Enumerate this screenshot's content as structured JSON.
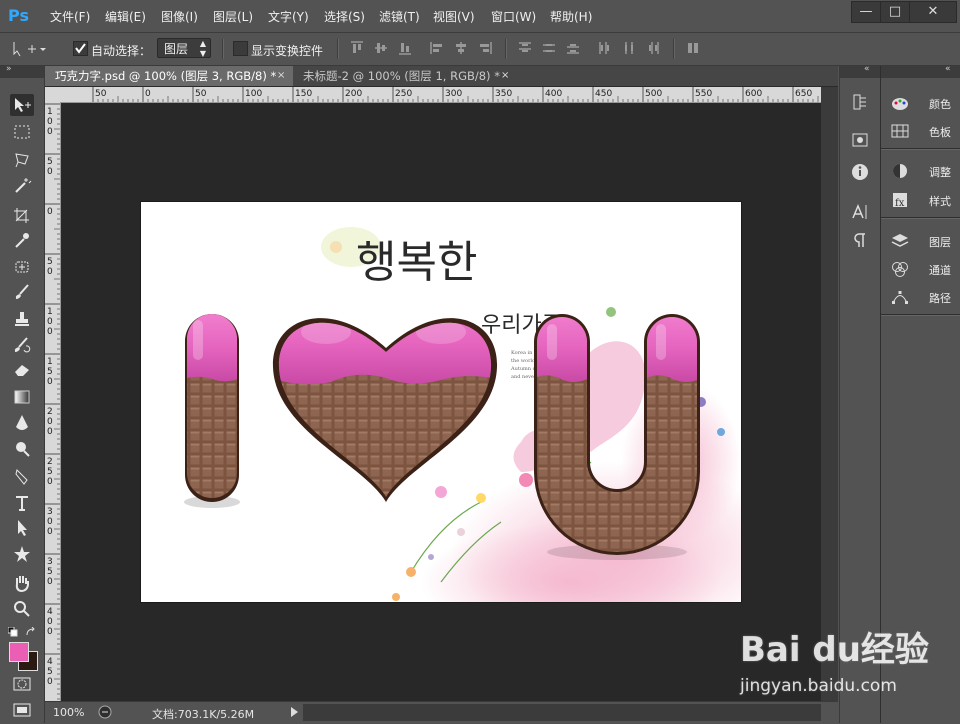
{
  "app": {
    "logo": "Ps"
  },
  "menu": [
    {
      "label": "文件(F)"
    },
    {
      "label": "编辑(E)"
    },
    {
      "label": "图像(I)"
    },
    {
      "label": "图层(L)"
    },
    {
      "label": "文字(Y)"
    },
    {
      "label": "选择(S)"
    },
    {
      "label": "滤镜(T)"
    },
    {
      "label": "视图(V)"
    },
    {
      "label": "窗口(W)"
    },
    {
      "label": "帮助(H)"
    }
  ],
  "window_controls": {
    "minimize": "—",
    "maximize": "□",
    "close": "✕"
  },
  "options_bar": {
    "auto_select_label": "自动选择：",
    "auto_select_checked": true,
    "layer_mode": "图层",
    "show_transform_label": "显示变换控件",
    "show_transform_checked": false
  },
  "tabs": [
    {
      "label": "巧克力字.psd @ 100% (图层 3, RGB/8) *",
      "close": "×",
      "active": true
    },
    {
      "label": "未标题-2 @ 100% (图层 1, RGB/8) *",
      "close": "×",
      "active": false
    }
  ],
  "ruler_top": [
    "50",
    "0",
    "50",
    "100",
    "150",
    "200",
    "250",
    "300",
    "350",
    "400",
    "450",
    "500",
    "550",
    "600",
    "650"
  ],
  "ruler_left": [
    "1\n0\n0",
    "5\n0",
    "0",
    "5\n0",
    "1\n0\n0",
    "1\n5\n0",
    "2\n0\n0",
    "2\n5\n0",
    "3\n0\n0",
    "3\n5\n0",
    "4\n0\n0",
    "4\n5\n0",
    "5\n0\n0"
  ],
  "artwork": {
    "korean_title": "행복한",
    "korean_sub": "우리가족",
    "small_text": [
      "Korea in February.",
      "the world.",
      "Autumn days Andal has blue",
      "and never engineered."
    ],
    "letter_i": "I",
    "letter_u": "U",
    "chocolate_color": "#4a2b1c",
    "pink_color": "#e96bc1"
  },
  "status": {
    "zoom": "100%",
    "doc_info": "文档:703.1K/5.26M"
  },
  "panels": [
    {
      "label": "颜色",
      "icon": "palette-icon"
    },
    {
      "label": "色板",
      "icon": "swatches-icon"
    },
    {
      "label": "调整",
      "icon": "adjustments-icon"
    },
    {
      "label": "样式",
      "icon": "styles-icon"
    },
    {
      "label": "图层",
      "icon": "layers-icon"
    },
    {
      "label": "通道",
      "icon": "channels-icon"
    },
    {
      "label": "路径",
      "icon": "paths-icon"
    }
  ],
  "colors": {
    "foreground": "#ea5fb4",
    "background": "#2a1a12"
  },
  "watermark": {
    "brand": "Bai du经验",
    "url": "jingyan.baidu.com"
  }
}
